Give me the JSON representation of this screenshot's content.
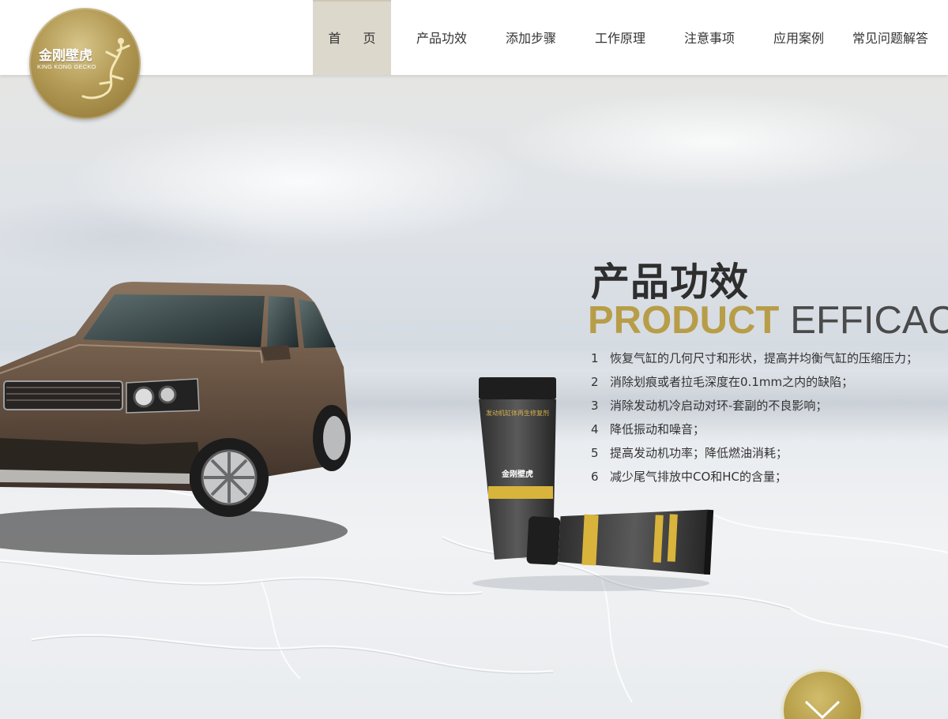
{
  "logo": {
    "cn": "金刚壁虎",
    "en": "KING KONG GECKO"
  },
  "nav": {
    "items": [
      {
        "label": "首页",
        "active": true
      },
      {
        "label": "产品功效",
        "active": false
      },
      {
        "label": "添加步骤",
        "active": false
      },
      {
        "label": "工作原理",
        "active": false
      },
      {
        "label": "注意事项",
        "active": false
      },
      {
        "label": "应用案例",
        "active": false
      },
      {
        "label": "常见问题解答",
        "active": false
      }
    ]
  },
  "section": {
    "title_cn": "产品功效",
    "title_en_highlight": "PRODUCT",
    "title_en_rest": "EFFICACY",
    "features": [
      {
        "num": "1",
        "text": "恢复气缸的几何尺寸和形状，提高并均衡气缸的压缩压力；"
      },
      {
        "num": "2",
        "text": "消除划痕或者拉毛深度在0.1mm之内的缺陷；"
      },
      {
        "num": "3",
        "text": "消除发动机冷启动对环-套副的不良影响；"
      },
      {
        "num": "4",
        "text": "降低振动和噪音；"
      },
      {
        "num": "5",
        "text": "提高发动机功率；降低燃油消耗；"
      },
      {
        "num": "6",
        "text": "减少尾气排放中CO和HC的含量；"
      }
    ]
  },
  "product": {
    "tube_label_cn": "金刚壁虎"
  },
  "icons": {
    "scroll": "chevron-down-icon",
    "logo": "gecko-icon"
  },
  "colors": {
    "gold": "#b89d48",
    "nav_active_bg": "#ddd8cc",
    "text": "#333333"
  }
}
